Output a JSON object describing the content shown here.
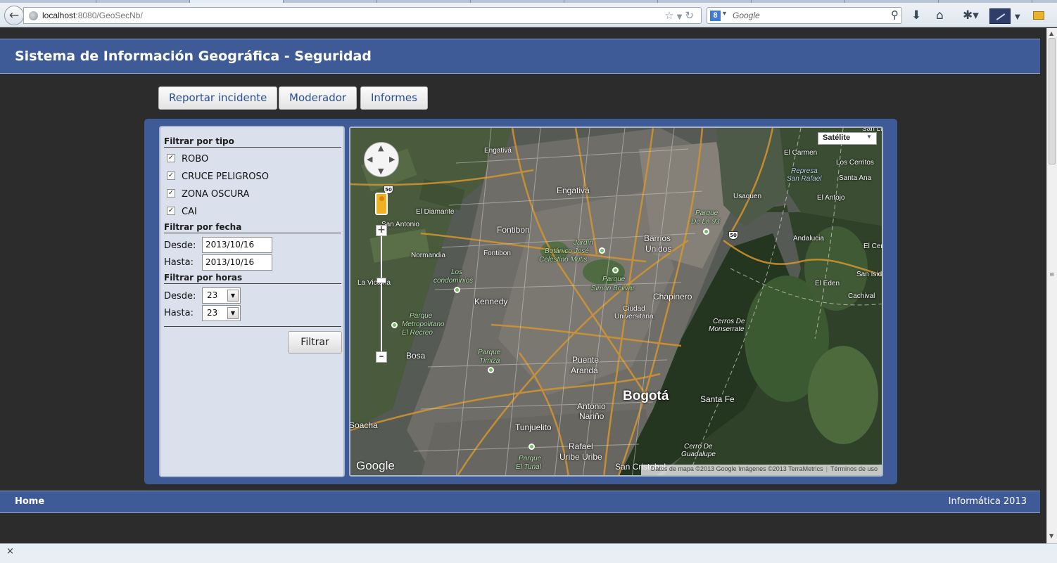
{
  "browser": {
    "url_host": "localhost",
    "url_rest": ":8080/GeoSecNb/",
    "search_placeholder": "Google",
    "search_engine_badge": "8",
    "icons": [
      "back-arrow-icon",
      "globe-icon",
      "star-icon",
      "reload-icon",
      "google-search-icon",
      "magnifier-icon",
      "download-icon",
      "home-icon",
      "bookmarks-icon",
      "extension-icon",
      "notes-icon"
    ]
  },
  "header": {
    "title": "Sistema de Información Geográfica - Seguridad"
  },
  "nav": {
    "buttons": [
      {
        "label": "Reportar incidente"
      },
      {
        "label": "Moderador"
      },
      {
        "label": "Informes"
      }
    ]
  },
  "filters": {
    "type": {
      "title": "Filtrar por tipo",
      "items": [
        {
          "label": "ROBO",
          "checked": true
        },
        {
          "label": "CRUCE PELIGROSO",
          "checked": true
        },
        {
          "label": "ZONA OSCURA",
          "checked": true
        },
        {
          "label": "CAI",
          "checked": true
        }
      ]
    },
    "date": {
      "title": "Filtrar por fecha",
      "from_label": "Desde:",
      "from_value": "2013/10/16",
      "to_label": "Hasta:",
      "to_value": "2013/10/16"
    },
    "hours": {
      "title": "Filtrar por horas",
      "from_label": "Desde:",
      "from_value": "23",
      "to_label": "Hasta:",
      "to_value": "23"
    },
    "submit_label": "Filtrar"
  },
  "map": {
    "type_selector": "Satélite",
    "logo": "Google",
    "attribution": "Datos de mapa ©2013 Google Imágenes ©2013 TerraMetrics",
    "terms": "Términos de uso",
    "route_shield": "50",
    "labels": {
      "engativa_top": "Engativá",
      "engativa": "Engativá",
      "el_diamante": "El Diamante",
      "san_antonio": "San Antonio",
      "fontibon": "Fontibon",
      "fontibon2": "Fontibon",
      "normandia": "Normandia",
      "jardin": "Jardín",
      "botanico": "Botánico José",
      "celestino": "Celestino Mutis",
      "barrios_unidos_1": "Barrios",
      "barrios_unidos_2": "Unidos",
      "parque_93_1": "Parque",
      "parque_93_2": "De La 93",
      "usaquen": "Usaquen",
      "el_carmen": "El Carmen",
      "represa_1": "Represa",
      "represa_2": "San Rafael",
      "los_cerritos": "Los Cerritos",
      "santa_ana": "Santa Ana",
      "el_antojo": "El Antojo",
      "san_lu": "San Lu",
      "andalucia": "Andalucia",
      "el_cer": "El Cer",
      "san_isid": "San Isid",
      "el_eden": "El Eden",
      "cachival": "Cachival",
      "los_condominios_1": "Los",
      "los_condominios_2": "condominios",
      "parque_sb_1": "Parque",
      "parque_sb_2": "Simon Bolivar",
      "chapinero": "Chapinero",
      "ciudad_1": "Ciudad",
      "ciudad_2": "Universitaria",
      "la_victoria": "La Victoria",
      "kennedy": "Kennedy",
      "cerros_1": "Cerros De",
      "cerros_2": "Monserrate",
      "pm_1": "Parque",
      "pm_2": "Metropolitano",
      "pm_3": "El Recreo",
      "bosa": "Bosa",
      "pt_1": "Parque",
      "pt_2": "Timiza",
      "puente_1": "Puente",
      "puente_2": "Aranda",
      "bogota": "Bogotá",
      "santa_fe": "Santa Fe",
      "antonio_1": "Antonio",
      "antonio_2": "Nariño",
      "soacha": "Soacha",
      "tunjuelito": "Tunjuelito",
      "rafael_1": "Rafael",
      "rafael_2": "Uribe Uribe",
      "cerro_1": "Cerro De",
      "cerro_2": "Guadalupe",
      "pet_1": "Parque",
      "pet_2": "El Tunal",
      "san_cristobal": "San Cristobal"
    }
  },
  "footer": {
    "home_label": "Home",
    "right_text": "Informática 2013"
  },
  "statusbar": {
    "close_glyph": "×"
  }
}
